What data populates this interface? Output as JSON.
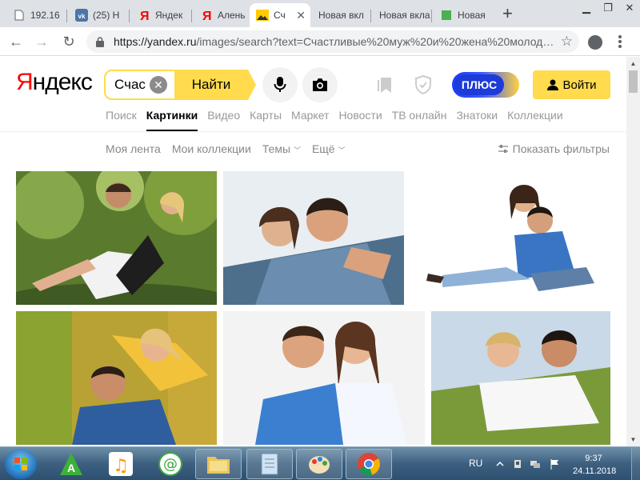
{
  "browser": {
    "tabs": [
      {
        "title": "192.16",
        "favicon": "page-icon",
        "active": false
      },
      {
        "title": "(25) Н",
        "favicon": "vk-icon",
        "active": false
      },
      {
        "title": "Яндек",
        "favicon": "yandex-icon",
        "active": false
      },
      {
        "title": "Алень",
        "favicon": "yandex-icon",
        "active": false
      },
      {
        "title": "Сч",
        "favicon": "images-icon",
        "active": true
      },
      {
        "title": "Новая вкл",
        "favicon": "none",
        "active": false
      },
      {
        "title": "Новая вкла",
        "favicon": "none",
        "active": false
      },
      {
        "title": "Новая",
        "favicon": "green-square-icon",
        "active": false
      }
    ],
    "new_tab_label": "+",
    "url_host": "https://yandex.ru",
    "url_path": "/images/search?text=Счастливые%20муж%20и%20жена%20молод…"
  },
  "yandex": {
    "logo_first": "Я",
    "logo_rest": "ндекс",
    "search_value": "Счас",
    "search_button": "Найти",
    "plus_label": "ПЛЮС",
    "login_label": "Войти",
    "services": [
      {
        "label": "Поиск",
        "active": false
      },
      {
        "label": "Картинки",
        "active": true
      },
      {
        "label": "Видео",
        "active": false
      },
      {
        "label": "Карты",
        "active": false
      },
      {
        "label": "Маркет",
        "active": false
      },
      {
        "label": "Новости",
        "active": false
      },
      {
        "label": "ТВ онлайн",
        "active": false
      },
      {
        "label": "Знатоки",
        "active": false
      },
      {
        "label": "Коллекции",
        "active": false
      }
    ],
    "subnav": {
      "feed": "Моя лента",
      "collections": "Мои коллекции",
      "themes": "Темы",
      "more": "Ещё",
      "filters": "Показать фильтры"
    }
  },
  "results": [
    {
      "scene": "couple-outdoor-carry",
      "bg": "#5a7a2e"
    },
    {
      "scene": "couple-hug-white",
      "bg": "#e9eef2"
    },
    {
      "scene": "couple-sitting-floor",
      "bg": "#ffffff"
    },
    {
      "scene": "couple-piggyback-autumn",
      "bg": "#b8a233"
    },
    {
      "scene": "couple-embrace-studio",
      "bg": "#f3f3f3"
    },
    {
      "scene": "couple-lying-grass",
      "bg": "#c9d9e8"
    }
  ],
  "taskbar": {
    "apps": [
      "start-button",
      "aimp-icon",
      "music-icon",
      "mail-icon",
      "folder-icon",
      "notepad-icon",
      "paint-icon",
      "chrome-icon"
    ],
    "lang": "RU",
    "time": "9:37",
    "date": "24.11.2018"
  }
}
